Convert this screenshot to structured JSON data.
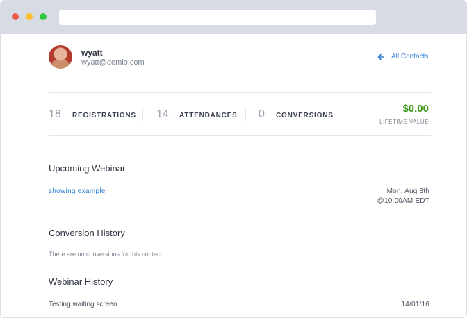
{
  "contact": {
    "name": "wyatt",
    "email": "wyatt@demio.com"
  },
  "nav": {
    "back_label": "All Contacts"
  },
  "stats": [
    {
      "value": "18",
      "label": "REGISTRATIONS"
    },
    {
      "value": "14",
      "label": "ATTENDANCES"
    },
    {
      "value": "0",
      "label": "CONVERSIONS"
    }
  ],
  "lifetime": {
    "amount": "$0.00",
    "label": "LIFETIME VALUE"
  },
  "upcoming": {
    "title": "Upcoming Webinar",
    "webinar_name": "showing example",
    "date": "Mon, Aug 8th",
    "time": "@10:00AM EDT"
  },
  "conversion_history": {
    "title": "Conversion History",
    "empty_text": "There are no conversions for this contact."
  },
  "webinar_history": {
    "title": "Webinar History",
    "rows": [
      {
        "name": "Testing waiting screen",
        "date": "14/01/16"
      }
    ]
  },
  "colors": {
    "accent": "#2d7fd3",
    "money": "#3d9a16"
  }
}
